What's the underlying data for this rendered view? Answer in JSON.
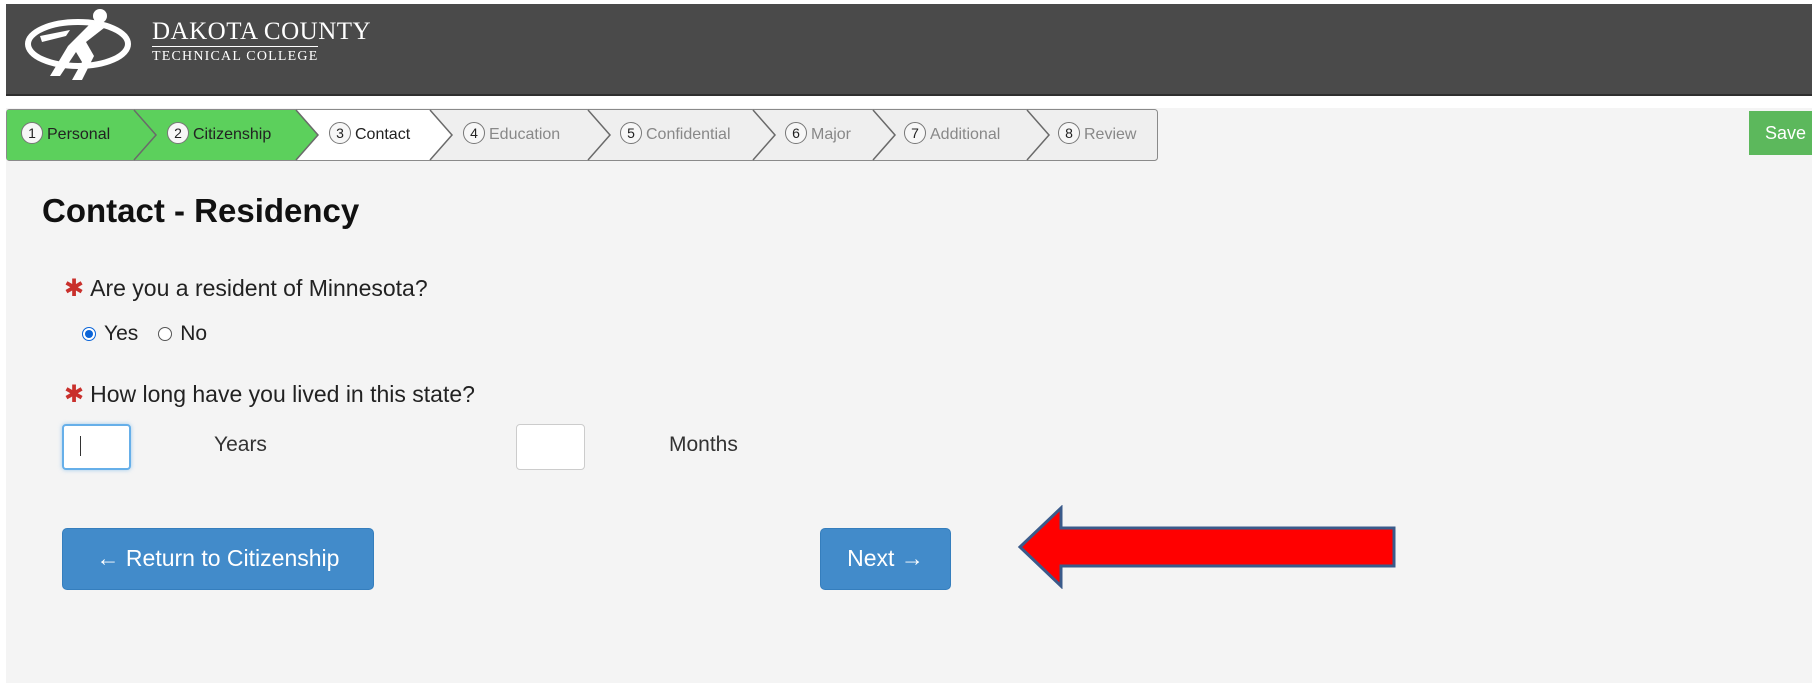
{
  "header": {
    "logo_line1": "DAKOTA COUNTY",
    "logo_line2": "TECHNICAL COLLEGE"
  },
  "wizard": {
    "steps": [
      {
        "num": "1",
        "label": "Personal",
        "state": "completed"
      },
      {
        "num": "2",
        "label": "Citizenship",
        "state": "completed"
      },
      {
        "num": "3",
        "label": "Contact",
        "state": "current"
      },
      {
        "num": "4",
        "label": "Education",
        "state": "inactive"
      },
      {
        "num": "5",
        "label": "Confidential",
        "state": "inactive"
      },
      {
        "num": "6",
        "label": "Major",
        "state": "inactive"
      },
      {
        "num": "7",
        "label": "Additional",
        "state": "inactive"
      },
      {
        "num": "8",
        "label": "Review",
        "state": "inactive"
      }
    ]
  },
  "save_label": "Save",
  "page_title": "Contact - Residency",
  "question1": {
    "label": "Are you a resident of Minnesota?",
    "options": [
      {
        "label": "Yes",
        "selected": true
      },
      {
        "label": "No",
        "selected": false
      }
    ]
  },
  "question2": {
    "label": "How long have you lived in this state?",
    "years_value": "",
    "years_unit": "Years",
    "months_value": "",
    "months_unit": "Months"
  },
  "buttons": {
    "back_label": "← Return to Citizenship",
    "next_label": "Next →"
  },
  "annotation_arrow": "red-arrow-pointing-left",
  "colors": {
    "header_bg": "#4a4a4a",
    "completed_step": "#5cd05c",
    "primary_button": "#428bca",
    "save_button": "#5cb85c",
    "required": "#c9302c",
    "arrow": "#ff0000"
  }
}
